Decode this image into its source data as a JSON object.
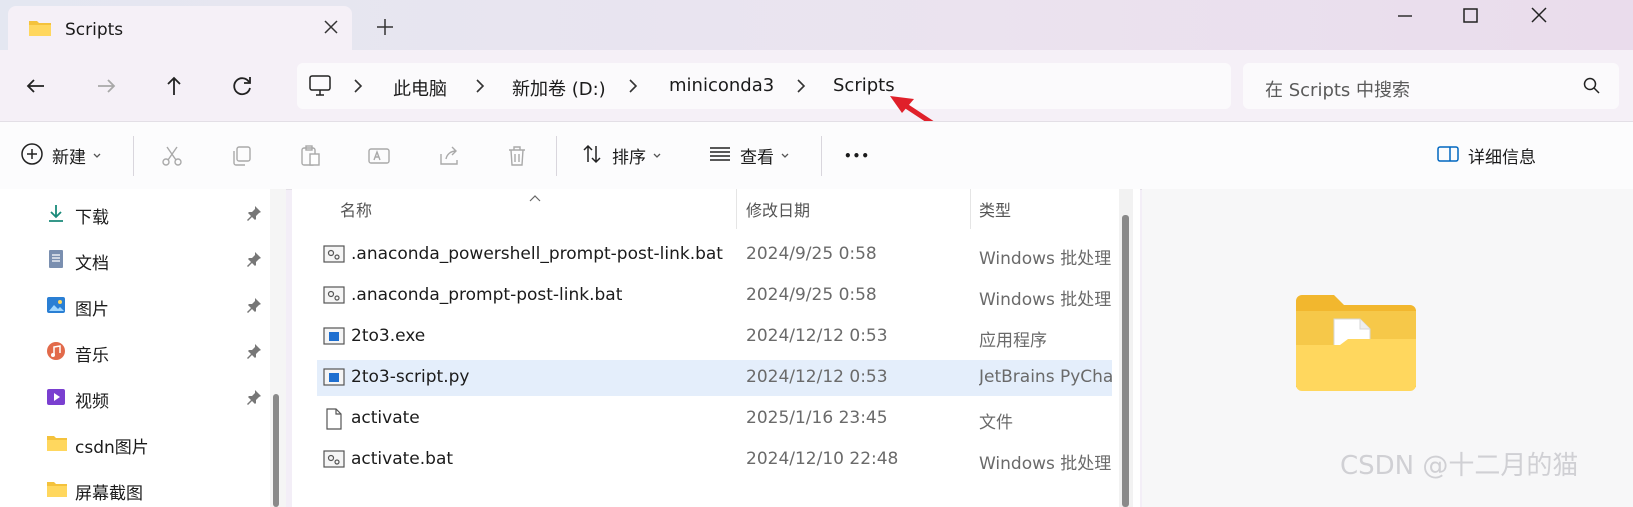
{
  "window": {
    "tab_title": "Scripts",
    "controls": [
      "minimize",
      "maximize",
      "close"
    ]
  },
  "nav": {
    "breadcrumb": [
      "此电脑",
      "新加卷 (D:)",
      "miniconda3",
      "Scripts"
    ],
    "search_placeholder": "在 Scripts 中搜索"
  },
  "toolbar": {
    "new_label": "新建",
    "sort_label": "排序",
    "view_label": "查看",
    "more_label": "•••",
    "details_label": "详细信息"
  },
  "sidebar": {
    "items": [
      {
        "label": "下载",
        "icon": "download-icon",
        "pinned": true
      },
      {
        "label": "文档",
        "icon": "documents-icon",
        "pinned": true
      },
      {
        "label": "图片",
        "icon": "pictures-icon",
        "pinned": true
      },
      {
        "label": "音乐",
        "icon": "music-icon",
        "pinned": true
      },
      {
        "label": "视频",
        "icon": "videos-icon",
        "pinned": true
      },
      {
        "label": "csdn图片",
        "icon": "folder-icon",
        "pinned": false
      },
      {
        "label": "屏幕截图",
        "icon": "folder-icon",
        "pinned": false
      }
    ]
  },
  "files": {
    "columns": {
      "name": "名称",
      "date": "修改日期",
      "type": "类型"
    },
    "rows": [
      {
        "name": ".anaconda_powershell_prompt-post-link.bat",
        "date": "2024/9/25 0:58",
        "type": "Windows 批处理文件",
        "icon": "batch-file-icon"
      },
      {
        "name": ".anaconda_prompt-post-link.bat",
        "date": "2024/9/25 0:58",
        "type": "Windows 批处理文件",
        "icon": "batch-file-icon"
      },
      {
        "name": "2to3.exe",
        "date": "2024/12/12 0:53",
        "type": "应用程序",
        "icon": "exe-file-icon"
      },
      {
        "name": "2to3-script.py",
        "date": "2024/12/12 0:53",
        "type": "JetBrains PyCharm",
        "icon": "py-file-icon",
        "selected": true
      },
      {
        "name": "activate",
        "date": "2025/1/16 23:45",
        "type": "文件",
        "icon": "blank-file-icon"
      },
      {
        "name": "activate.bat",
        "date": "2024/12/10 22:48",
        "type": "Windows 批处理文件",
        "icon": "batch-file-icon"
      }
    ]
  },
  "watermark": "CSDN @十二月的猫",
  "colors": {
    "accent": "#0067c0",
    "annotation_arrow": "#e0202a",
    "selection": "#e4eefb"
  }
}
